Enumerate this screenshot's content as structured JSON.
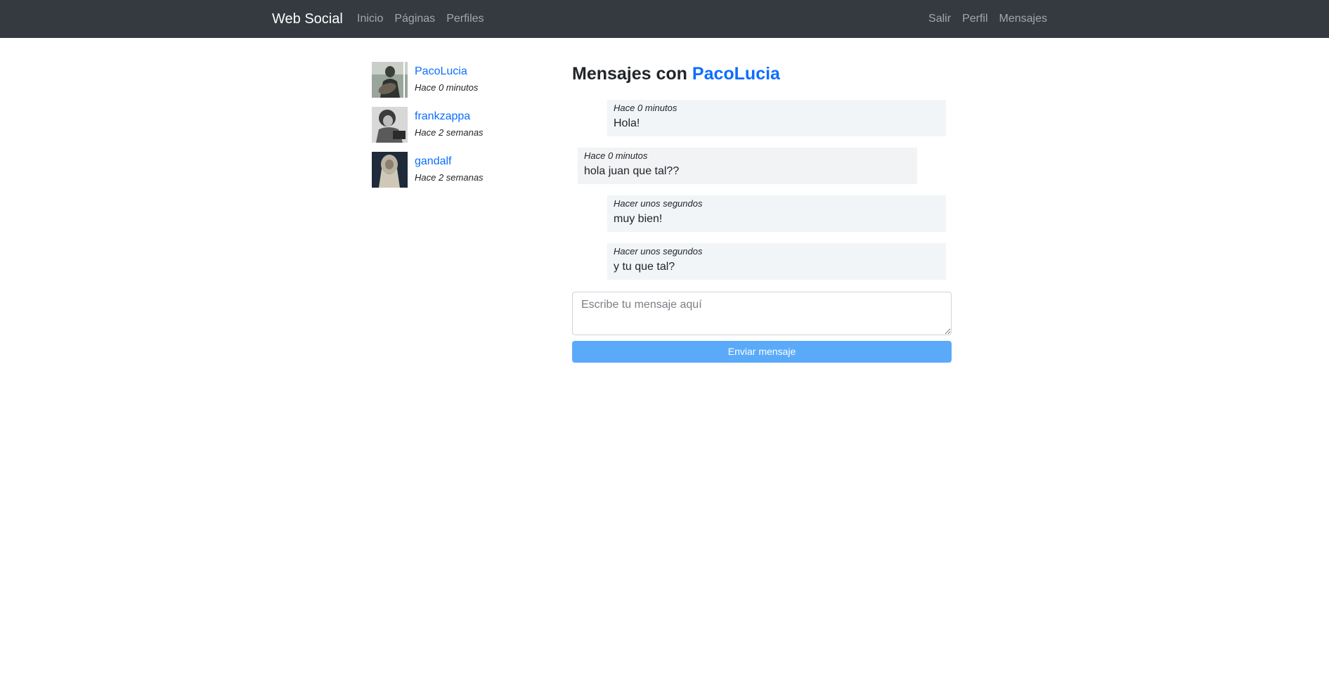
{
  "navbar": {
    "brand": "Web Social",
    "left_links": [
      "Inicio",
      "Páginas",
      "Perfiles"
    ],
    "right_links": [
      "Salir",
      "Perfil",
      "Mensajes"
    ],
    "background_color": "#343a40"
  },
  "conversations": [
    {
      "username": "PacoLucia",
      "time": "Hace 0 minutos"
    },
    {
      "username": "frankzappa",
      "time": "Hace 2 semanas"
    },
    {
      "username": "gandalf",
      "time": "Hace 2 semanas"
    }
  ],
  "chat": {
    "title_prefix": "Mensajes con",
    "partner": "PacoLucia",
    "messages": [
      {
        "direction": "sent",
        "time": "Hace 0 minutos",
        "text": "Hola!"
      },
      {
        "direction": "received",
        "time": "Hace 0 minutos",
        "text": "hola juan que tal??"
      },
      {
        "direction": "sent",
        "time": "Hacer unos segundos",
        "text": "muy bien!"
      },
      {
        "direction": "sent",
        "time": "Hacer unos segundos",
        "text": "y tu que tal?"
      }
    ]
  },
  "compose": {
    "placeholder": "Escribe tu mensaje aquí",
    "value": "",
    "send_label": "Enviar mensaje",
    "button_color": "#5aaaf9"
  },
  "colors": {
    "link": "#0d6efd",
    "sent_bubble": "#f1f5f8",
    "received_bubble": "#f1f3f5"
  }
}
